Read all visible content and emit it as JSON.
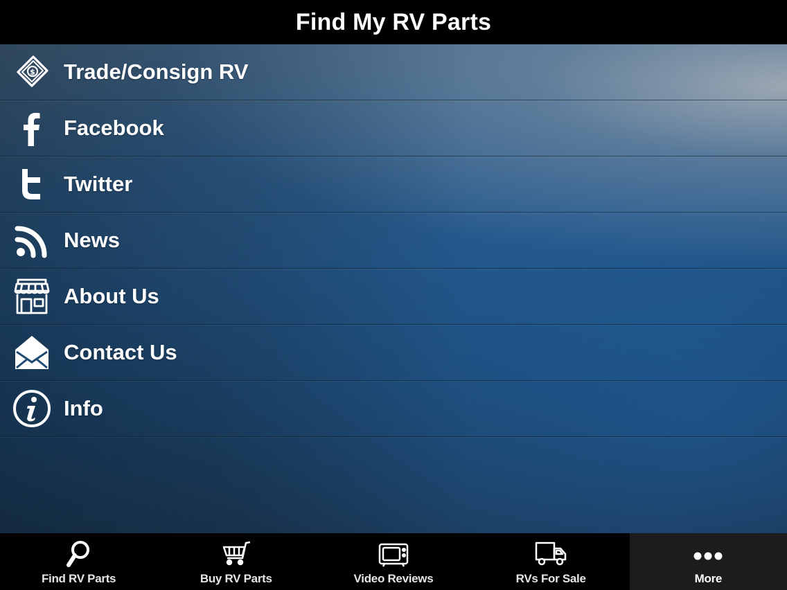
{
  "header": {
    "title": "Find My RV Parts"
  },
  "menu": {
    "items": [
      {
        "label": "Trade/Consign RV",
        "icon": "dollar-bill-icon"
      },
      {
        "label": "Facebook",
        "icon": "facebook-icon"
      },
      {
        "label": "Twitter",
        "icon": "twitter-icon"
      },
      {
        "label": "News",
        "icon": "rss-icon"
      },
      {
        "label": "About Us",
        "icon": "storefront-icon"
      },
      {
        "label": "Contact Us",
        "icon": "envelope-icon"
      },
      {
        "label": "Info",
        "icon": "info-icon"
      }
    ]
  },
  "tabbar": {
    "tabs": [
      {
        "label": "Find RV Parts",
        "icon": "magnifier-icon"
      },
      {
        "label": "Buy RV Parts",
        "icon": "shopping-cart-icon"
      },
      {
        "label": "Video Reviews",
        "icon": "tv-icon"
      },
      {
        "label": "RVs For Sale",
        "icon": "truck-icon"
      },
      {
        "label": "More",
        "icon": "more-dots-icon"
      }
    ],
    "active_index": 4
  },
  "colors": {
    "bar_bg": "#000000",
    "active_tab_bg": "#1c1c1c",
    "text": "#ffffff"
  }
}
